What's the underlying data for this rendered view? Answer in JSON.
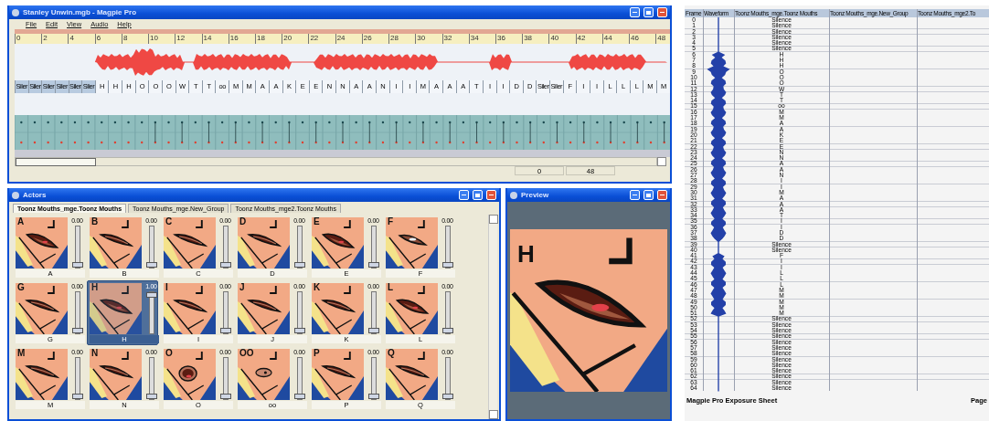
{
  "timeline_window": {
    "title": "Stanley Unwin.mgb - Magpie Pro",
    "menu": [
      "File",
      "Edit",
      "View",
      "Audio",
      "Help"
    ],
    "ruler": [
      "0",
      "2",
      "4",
      "6",
      "8",
      "10",
      "12",
      "14",
      "16",
      "18",
      "20",
      "22",
      "24",
      "26",
      "28",
      "30",
      "32",
      "34",
      "36",
      "38",
      "40",
      "42",
      "44",
      "46",
      "48"
    ],
    "frames": [
      {
        "label": "Siler",
        "selected": true
      },
      {
        "label": "Siler",
        "selected": true
      },
      {
        "label": "Siler",
        "selected": true
      },
      {
        "label": "Siler",
        "selected": true
      },
      {
        "label": "Siler",
        "selected": true
      },
      {
        "label": "Siler",
        "selected": true
      },
      {
        "label": "H",
        "selected": false
      },
      {
        "label": "H",
        "selected": false
      },
      {
        "label": "H",
        "selected": false
      },
      {
        "label": "O",
        "selected": false
      },
      {
        "label": "O",
        "selected": false
      },
      {
        "label": "O",
        "selected": false
      },
      {
        "label": "W",
        "selected": false
      },
      {
        "label": "T",
        "selected": false
      },
      {
        "label": "T",
        "selected": false
      },
      {
        "label": "oo",
        "selected": false
      },
      {
        "label": "M",
        "selected": false
      },
      {
        "label": "M",
        "selected": false
      },
      {
        "label": "A",
        "selected": false
      },
      {
        "label": "A",
        "selected": false
      },
      {
        "label": "K",
        "selected": false
      },
      {
        "label": "E",
        "selected": false
      },
      {
        "label": "E",
        "selected": false
      },
      {
        "label": "N",
        "selected": false
      },
      {
        "label": "N",
        "selected": false
      },
      {
        "label": "A",
        "selected": false
      },
      {
        "label": "A",
        "selected": false
      },
      {
        "label": "N",
        "selected": false
      },
      {
        "label": "I",
        "selected": false
      },
      {
        "label": "I",
        "selected": false
      },
      {
        "label": "M",
        "selected": false
      },
      {
        "label": "A",
        "selected": false
      },
      {
        "label": "A",
        "selected": false
      },
      {
        "label": "A",
        "selected": false
      },
      {
        "label": "T",
        "selected": false
      },
      {
        "label": "I",
        "selected": false
      },
      {
        "label": "I",
        "selected": false
      },
      {
        "label": "D",
        "selected": false
      },
      {
        "label": "D",
        "selected": false
      },
      {
        "label": "Siler",
        "selected": false
      },
      {
        "label": "Siler",
        "selected": false
      },
      {
        "label": "F",
        "selected": false
      },
      {
        "label": "I",
        "selected": false
      },
      {
        "label": "I",
        "selected": false
      },
      {
        "label": "L",
        "selected": false
      },
      {
        "label": "L",
        "selected": false
      },
      {
        "label": "L",
        "selected": false
      },
      {
        "label": "M",
        "selected": false
      },
      {
        "label": "M",
        "selected": false
      }
    ],
    "start_frame": "0",
    "end_frame": "48"
  },
  "actors_window": {
    "title": "Actors",
    "tabs": [
      {
        "label": "Toonz Mouths_mge.Toonz Mouths",
        "selected": true
      },
      {
        "label": "Toonz Mouths_mge.New_Group",
        "selected": false
      },
      {
        "label": "Toonz Mouths_mge2.Toonz Mouths",
        "selected": false
      }
    ],
    "mouths": [
      {
        "letter": "A",
        "caption": "A",
        "value": "0.00",
        "level": 0,
        "selected": false,
        "kind": "open"
      },
      {
        "letter": "B",
        "caption": "B",
        "value": "0.00",
        "level": 0,
        "selected": false,
        "kind": "narrow"
      },
      {
        "letter": "C",
        "caption": "C",
        "value": "0.00",
        "level": 0,
        "selected": false,
        "kind": "narrow"
      },
      {
        "letter": "D",
        "caption": "D",
        "value": "0.00",
        "level": 0,
        "selected": false,
        "kind": "narrow"
      },
      {
        "letter": "E",
        "caption": "E",
        "value": "0.00",
        "level": 0,
        "selected": false,
        "kind": "open"
      },
      {
        "letter": "F",
        "caption": "F",
        "value": "0.00",
        "level": 0,
        "selected": false,
        "kind": "teeth"
      },
      {
        "letter": "G",
        "caption": "G",
        "value": "0.00",
        "level": 0,
        "selected": false,
        "kind": "narrow"
      },
      {
        "letter": "H",
        "caption": "H",
        "value": "1.00",
        "level": 1,
        "selected": true,
        "kind": "open"
      },
      {
        "letter": "I",
        "caption": "I",
        "value": "0.00",
        "level": 0,
        "selected": false,
        "kind": "narrow"
      },
      {
        "letter": "J",
        "caption": "J",
        "value": "0.00",
        "level": 0,
        "selected": false,
        "kind": "narrow"
      },
      {
        "letter": "K",
        "caption": "K",
        "value": "0.00",
        "level": 0,
        "selected": false,
        "kind": "narrow"
      },
      {
        "letter": "L",
        "caption": "L",
        "value": "0.00",
        "level": 0,
        "selected": false,
        "kind": "open"
      },
      {
        "letter": "M",
        "caption": "M",
        "value": "0.00",
        "level": 0,
        "selected": false,
        "kind": "narrow"
      },
      {
        "letter": "N",
        "caption": "N",
        "value": "0.00",
        "level": 0,
        "selected": false,
        "kind": "narrow"
      },
      {
        "letter": "O",
        "caption": "O",
        "value": "0.00",
        "level": 0,
        "selected": false,
        "kind": "round"
      },
      {
        "letter": "OO",
        "caption": "oo",
        "value": "0.00",
        "level": 0,
        "selected": false,
        "kind": "pucker"
      },
      {
        "letter": "P",
        "caption": "P",
        "value": "0.00",
        "level": 0,
        "selected": false,
        "kind": "narrow"
      },
      {
        "letter": "Q",
        "caption": "Q",
        "value": "0.00",
        "level": 0,
        "selected": false,
        "kind": "narrow"
      }
    ]
  },
  "preview_window": {
    "title": "Preview",
    "letter": "H",
    "kind": "open"
  },
  "exposure_sheet": {
    "columns": [
      "Frame",
      "Waveform",
      "Toonz Mouths_mge.Toonz Mouths",
      "Toonz Mouths_mge.New_Group",
      "Toonz Mouths_mge2.To"
    ],
    "rows": [
      {
        "frame": "0",
        "mouth": "Silence"
      },
      {
        "frame": "1",
        "mouth": "Silence"
      },
      {
        "frame": "2",
        "mouth": "Silence"
      },
      {
        "frame": "3",
        "mouth": "Silence"
      },
      {
        "frame": "4",
        "mouth": "Silence"
      },
      {
        "frame": "5",
        "mouth": "Silence"
      },
      {
        "frame": "6",
        "mouth": "H"
      },
      {
        "frame": "7",
        "mouth": "H"
      },
      {
        "frame": "8",
        "mouth": "H"
      },
      {
        "frame": "9",
        "mouth": "O"
      },
      {
        "frame": "10",
        "mouth": "O"
      },
      {
        "frame": "11",
        "mouth": "O"
      },
      {
        "frame": "12",
        "mouth": "W"
      },
      {
        "frame": "13",
        "mouth": "T"
      },
      {
        "frame": "14",
        "mouth": "T"
      },
      {
        "frame": "15",
        "mouth": "oo"
      },
      {
        "frame": "16",
        "mouth": "M"
      },
      {
        "frame": "17",
        "mouth": "M"
      },
      {
        "frame": "18",
        "mouth": "A"
      },
      {
        "frame": "19",
        "mouth": "A"
      },
      {
        "frame": "20",
        "mouth": "K"
      },
      {
        "frame": "21",
        "mouth": "E"
      },
      {
        "frame": "22",
        "mouth": "E"
      },
      {
        "frame": "23",
        "mouth": "N"
      },
      {
        "frame": "24",
        "mouth": "N"
      },
      {
        "frame": "25",
        "mouth": "A"
      },
      {
        "frame": "26",
        "mouth": "A"
      },
      {
        "frame": "27",
        "mouth": "N"
      },
      {
        "frame": "28",
        "mouth": "I"
      },
      {
        "frame": "29",
        "mouth": "I"
      },
      {
        "frame": "30",
        "mouth": "M"
      },
      {
        "frame": "31",
        "mouth": "A"
      },
      {
        "frame": "32",
        "mouth": "A"
      },
      {
        "frame": "33",
        "mouth": "A"
      },
      {
        "frame": "34",
        "mouth": "T"
      },
      {
        "frame": "35",
        "mouth": "I"
      },
      {
        "frame": "36",
        "mouth": "I"
      },
      {
        "frame": "37",
        "mouth": "D"
      },
      {
        "frame": "38",
        "mouth": "D"
      },
      {
        "frame": "39",
        "mouth": "Silence"
      },
      {
        "frame": "40",
        "mouth": "Silence"
      },
      {
        "frame": "41",
        "mouth": "F"
      },
      {
        "frame": "42",
        "mouth": "I"
      },
      {
        "frame": "43",
        "mouth": "I"
      },
      {
        "frame": "44",
        "mouth": "L"
      },
      {
        "frame": "45",
        "mouth": "L"
      },
      {
        "frame": "46",
        "mouth": "L"
      },
      {
        "frame": "47",
        "mouth": "M"
      },
      {
        "frame": "48",
        "mouth": "M"
      },
      {
        "frame": "49",
        "mouth": "M"
      },
      {
        "frame": "50",
        "mouth": "M"
      },
      {
        "frame": "51",
        "mouth": "M"
      },
      {
        "frame": "52",
        "mouth": "Silence"
      },
      {
        "frame": "53",
        "mouth": "Silence"
      },
      {
        "frame": "54",
        "mouth": "Silence"
      },
      {
        "frame": "55",
        "mouth": "Silence"
      },
      {
        "frame": "56",
        "mouth": "Silence"
      },
      {
        "frame": "57",
        "mouth": "Silence"
      },
      {
        "frame": "58",
        "mouth": "Silence"
      },
      {
        "frame": "59",
        "mouth": "Silence"
      },
      {
        "frame": "60",
        "mouth": "Silence"
      },
      {
        "frame": "61",
        "mouth": "Silence"
      },
      {
        "frame": "62",
        "mouth": "Silence"
      },
      {
        "frame": "63",
        "mouth": "Silence"
      },
      {
        "frame": "64",
        "mouth": "Silence"
      }
    ],
    "footer": "Magpie Pro Exposure Sheet",
    "page": "Page"
  }
}
